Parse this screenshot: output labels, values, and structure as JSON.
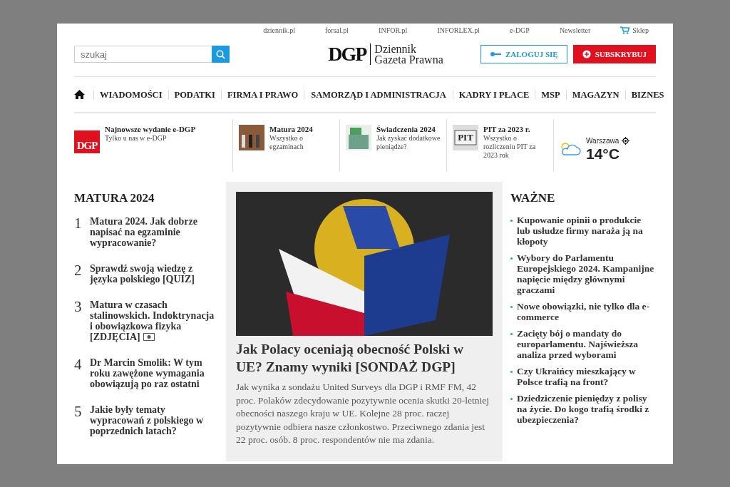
{
  "top_links": [
    {
      "label": "dziennik.pl"
    },
    {
      "label": "forsal.pl"
    },
    {
      "label": "INFOR.pl"
    },
    {
      "label": "INFORLEX.pl"
    },
    {
      "label": "e-DGP"
    },
    {
      "label": "Newsletter"
    },
    {
      "label": "Sklep",
      "kind": "shop"
    }
  ],
  "search": {
    "placeholder": "szukaj"
  },
  "logo": {
    "mark": "DGP",
    "line1": "Dziennik",
    "line2": "Gazeta Prawna"
  },
  "account_buttons": [
    {
      "label": "ZALOGUJ SIĘ",
      "kind": "login"
    },
    {
      "label": "SUBSKRYBUJ",
      "kind": "subscribe"
    }
  ],
  "nav": {
    "items": [
      "WIADOMOŚCI",
      "PODATKI",
      "FIRMA I PRAWO",
      "SAMORZĄD I ADMINISTRACJA",
      "KADRY I PŁACE",
      "MSP",
      "MAGAZYN",
      "BIZNES"
    ]
  },
  "promos": [
    {
      "kind": "logo",
      "badge": "DGP",
      "title": "Najnowsze wydanie e-DGP",
      "text": "Tylko u nas w e-DGP"
    },
    {
      "kind": "photo",
      "title": "Matura 2024",
      "text": "Wszystko o egzaminach"
    },
    {
      "kind": "photo",
      "title": "Świadczenia 2024",
      "text": "Jak zyskać dodatkowe pieniądze?"
    },
    {
      "kind": "photo",
      "badge": "PIT",
      "title": "PIT za 2023 r.",
      "text": "Wszystko o rozliczeniu PIT za 2023 rok"
    }
  ],
  "weather": {
    "city": "Warszawa",
    "temperature": "14°C"
  },
  "left_section": {
    "title": "MATURA 2024",
    "items": [
      {
        "number": "1",
        "text": "Matura 2024. Jak dobrze napisać na egzaminie wypracowanie?",
        "camera": false
      },
      {
        "number": "2",
        "text": "Sprawdź swoją wiedzę z języka polskiego [QUIZ]",
        "camera": false
      },
      {
        "number": "3",
        "text": "Matura w czasach stalinowskich. Indoktrynacja i obowiązkowa fizyka [ZDJĘCIA]",
        "camera": true
      },
      {
        "number": "4",
        "text": "Dr Marcin Smolik: W tym roku zawężone wymagania obowiązują po raz ostatni",
        "camera": false
      },
      {
        "number": "5",
        "text": "Jakie były tematy wypracowań z polskiego w poprzednich latach?",
        "camera": false
      }
    ]
  },
  "main_article": {
    "headline": "Jak Polacy oceniają obecność Polski w UE? Znamy wyniki [SONDAŻ DGP]",
    "lead": "Jak wynika z sondażu United Surveys dla DGP i RMF FM, 42 proc. Polaków zdecydowanie pozytywnie ocenia skutki 20-letniej obecności naszego kraju w UE. Kolejne 28 proc. raczej pozytywnie odbiera nasze członkostwo. Przeciwnego zdania jest 22 proc. osób. 8 proc. respondentów nie ma zdania."
  },
  "right_section": {
    "title": "WAŻNE",
    "items": [
      "Kupowanie opinii o produkcie lub usłudze firmy naraża ją na kłopoty",
      "Wybory do Parlamentu Europejskiego 2024. Kampanijne napięcie między głównymi graczami",
      "Nowe obowiązki, nie tylko dla e-commerce",
      "Zacięty bój o mandaty do europarlamentu. Najświeższa analiza przed wyborami",
      "Czy Ukraińcy mieszkający w Polsce trafią na front?",
      "Dziedziczenie pieniędzy z polisy na życie. Do kogo trafią środki z ubezpieczenia?"
    ]
  }
}
